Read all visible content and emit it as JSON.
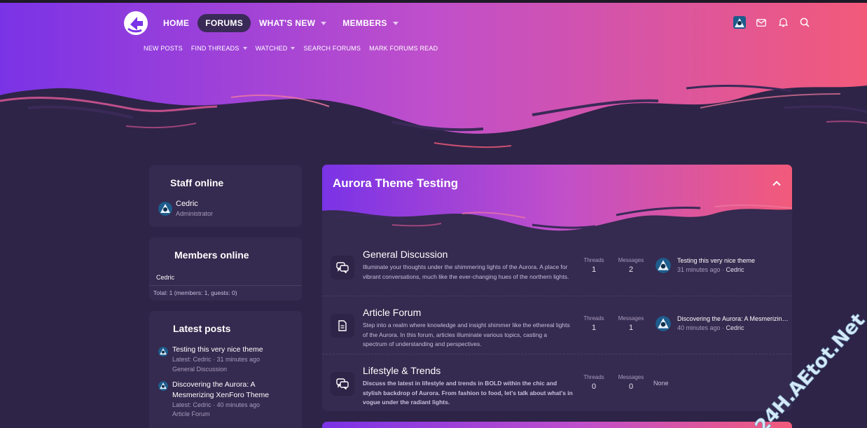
{
  "colors": {
    "background": "#2e2447",
    "block": "#352a4f",
    "gradient_start": "#7a33e6",
    "gradient_mid": "#c04fcb",
    "gradient_end": "#f25a7a",
    "muted_text": "#a99dbf"
  },
  "nav": {
    "logo_icon": "aurora-logo-icon",
    "tabs": [
      {
        "label": "HOME",
        "active": false,
        "dropdown": false
      },
      {
        "label": "FORUMS",
        "active": true,
        "dropdown": false
      },
      {
        "label": "WHAT'S NEW",
        "active": false,
        "dropdown": true
      },
      {
        "label": "MEMBERS",
        "active": false,
        "dropdown": true
      }
    ],
    "subnav": [
      {
        "label": "NEW POSTS",
        "dropdown": false
      },
      {
        "label": "FIND THREADS",
        "dropdown": true
      },
      {
        "label": "WATCHED",
        "dropdown": true
      },
      {
        "label": "SEARCH FORUMS",
        "dropdown": false
      },
      {
        "label": "MARK FORUMS READ",
        "dropdown": false
      }
    ],
    "right_icons": [
      "user-avatar-icon",
      "envelope-icon",
      "bell-icon",
      "search-icon"
    ]
  },
  "sidebar": {
    "staff_online": {
      "title": "Staff online",
      "user": {
        "name": "Cedric",
        "role": "Administrator"
      }
    },
    "members_online": {
      "title": "Members online",
      "users": "Cedric",
      "total": "Total: 1 (members: 1, guests: 0)"
    },
    "latest_posts": {
      "title": "Latest posts",
      "posts": [
        {
          "title": "Testing this very nice theme",
          "meta": "Latest: Cedric · 31 minutes ago",
          "forum": "General Discussion"
        },
        {
          "title_line1": "Discovering the Aurora: A",
          "title_line2": "Mesmerizing XenForo Theme",
          "meta": "Latest: Cedric · 40 minutes ago",
          "forum": "Article Forum"
        }
      ]
    }
  },
  "category": {
    "title": "Aurora Theme Testing",
    "collapse_icon": "chevron-up-icon",
    "nodes": [
      {
        "title": "General Discussion",
        "icon": "chat-bubbles-icon",
        "description": "Illuminate your thoughts under the shimmering lights of the Aurora. A place for vibrant conversations, much like the ever-changing hues of the northern lights.",
        "threads_label": "Threads",
        "threads": "1",
        "messages_label": "Messages",
        "messages": "2",
        "last_title": "Testing this very nice theme",
        "last_time": "31 minutes ago",
        "last_user": "Cedric"
      },
      {
        "title": "Article Forum",
        "icon": "document-icon",
        "description": "Step into a realm where knowledge and insight shimmer like the ethereal lights of the Aurora. In this forum, articles illuminate various topics, casting a spectrum of understanding and perspectives.",
        "threads_label": "Threads",
        "threads": "1",
        "messages_label": "Messages",
        "messages": "1",
        "last_title": "Discovering the Aurora: A Mesmerizing XenForo Theme",
        "last_time": "40 minutes ago",
        "last_user": "Cedric"
      },
      {
        "title": "Lifestyle & Trends",
        "icon": "chat-bubbles-icon",
        "description": "Discuss the latest in lifestyle and trends in BOLD within the chic and stylish backdrop of Aurora. From fashion to food, let's talk about what's in vogue under the radiant lights.",
        "threads_label": "Threads",
        "threads": "0",
        "messages_label": "Messages",
        "messages": "0",
        "last_none": "None"
      }
    ]
  },
  "watermark": "24H.AEtot.Net"
}
